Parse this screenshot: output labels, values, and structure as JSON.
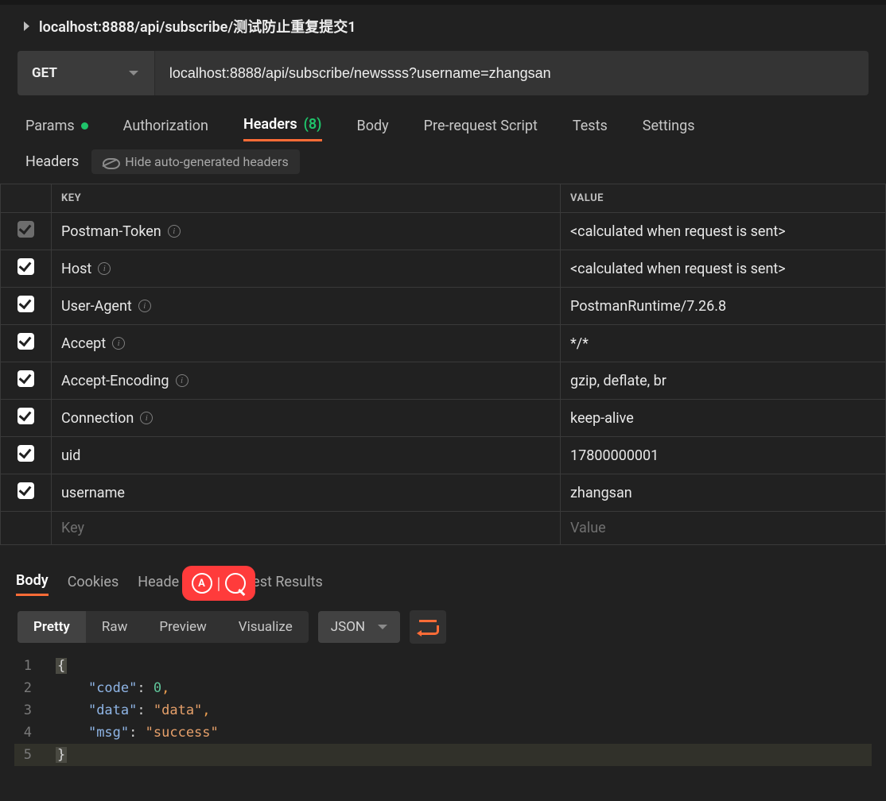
{
  "request": {
    "title": "localhost:8888/api/subscribe/测试防止重复提交1",
    "method": "GET",
    "url": "localhost:8888/api/subscribe/newssss?username=zhangsan"
  },
  "tabs": {
    "params": "Params",
    "authorization": "Authorization",
    "headers": "Headers",
    "headers_count": "(8)",
    "body": "Body",
    "prereq": "Pre-request Script",
    "tests": "Tests",
    "settings": "Settings"
  },
  "headers_section": {
    "label": "Headers",
    "hide_toggle": "Hide auto-generated headers",
    "columns": {
      "key": "KEY",
      "value": "VALUE"
    },
    "rows": [
      {
        "enabled": true,
        "dim": true,
        "key": "Postman-Token",
        "info": true,
        "value": "<calculated when request is sent>"
      },
      {
        "enabled": true,
        "dim": false,
        "key": "Host",
        "info": true,
        "value": "<calculated when request is sent>"
      },
      {
        "enabled": true,
        "dim": false,
        "key": "User-Agent",
        "info": true,
        "value": "PostmanRuntime/7.26.8"
      },
      {
        "enabled": true,
        "dim": false,
        "key": "Accept",
        "info": true,
        "value": "*/*"
      },
      {
        "enabled": true,
        "dim": false,
        "key": "Accept-Encoding",
        "info": true,
        "value": "gzip, deflate, br"
      },
      {
        "enabled": true,
        "dim": false,
        "key": "Connection",
        "info": true,
        "value": "keep-alive"
      },
      {
        "enabled": true,
        "dim": false,
        "key": "uid",
        "info": false,
        "value": "17800000001"
      },
      {
        "enabled": true,
        "dim": false,
        "key": "username",
        "info": false,
        "value": "zhangsan"
      }
    ],
    "placeholder_key": "Key",
    "placeholder_value": "Value"
  },
  "response_tabs": {
    "body": "Body",
    "cookies": "Cookies",
    "headers": "Heade",
    "test_results": "est Results"
  },
  "response_toolbar": {
    "pretty": "Pretty",
    "raw": "Raw",
    "preview": "Preview",
    "visualize": "Visualize",
    "format": "JSON"
  },
  "response_body": {
    "code_key": "\"code\"",
    "code_val": "0",
    "data_key": "\"data\"",
    "data_val": "\"data\"",
    "msg_key": "\"msg\"",
    "msg_val": "\"success\""
  },
  "line_numbers": {
    "l1": "1",
    "l2": "2",
    "l3": "3",
    "l4": "4",
    "l5": "5"
  }
}
